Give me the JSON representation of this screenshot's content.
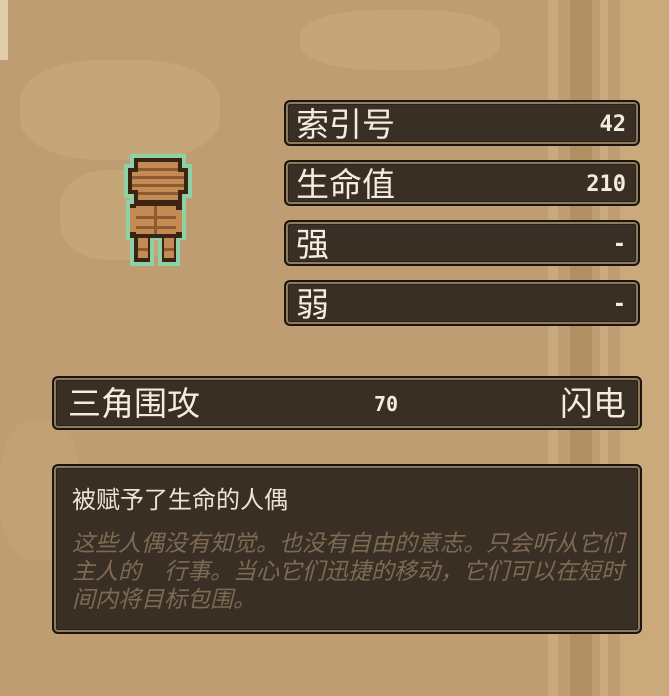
{
  "stats": [
    {
      "label": "索引号",
      "value": "42"
    },
    {
      "label": "生命值",
      "value": "210"
    },
    {
      "label": "强",
      "value": "-"
    },
    {
      "label": "弱",
      "value": "-"
    }
  ],
  "skill": {
    "name": "三角围攻",
    "power": "70",
    "element": "闪电"
  },
  "description": {
    "title": "被赋予了生命的人偶",
    "body": "这些人偶没有知觉。也没有自由的意志。只会听从它们主人的　行事。当心它们迅捷的移动，它们可以在短时间内将目标包围。"
  },
  "sprite": {
    "name": "golem-doll-sprite",
    "colors": {
      "outline": "#8fd1a6",
      "body": "#c48a53",
      "shade": "#8f5a30",
      "dark": "#3b2412"
    }
  },
  "colors": {
    "panel_bg": "#3a2f25",
    "panel_border": "#8f7a5d",
    "text": "#f3ece0",
    "muted_text": "#7d6a53",
    "parchment": "#bd9d71"
  }
}
